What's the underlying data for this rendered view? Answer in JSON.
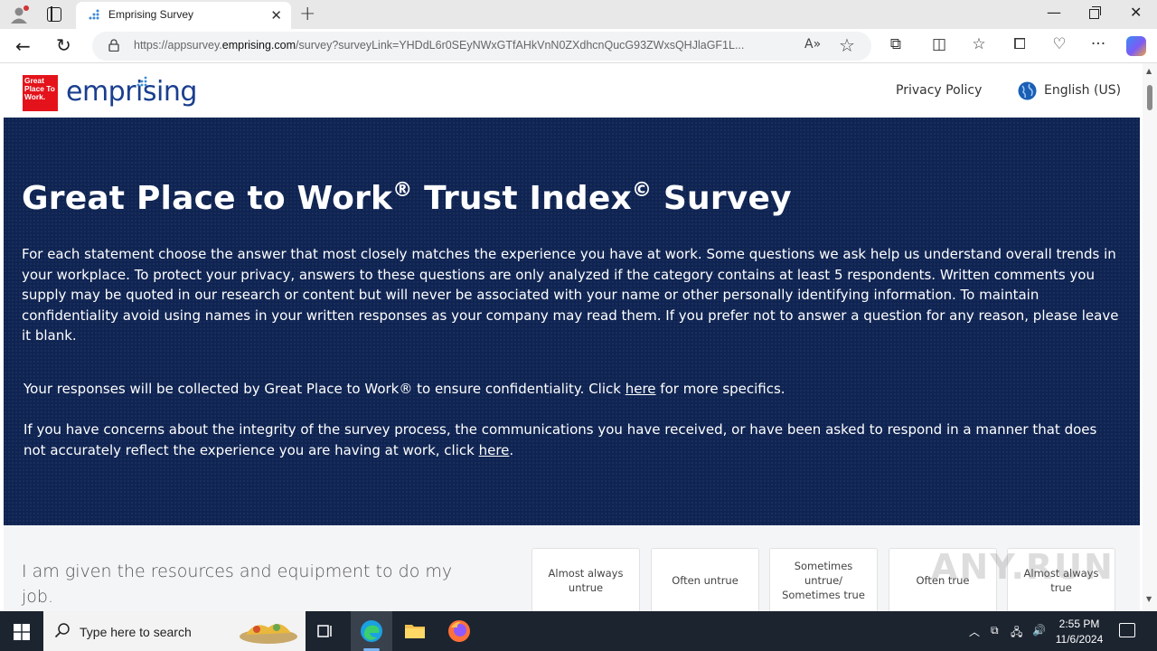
{
  "browser": {
    "tab_title": "Emprising Survey",
    "url_prefix": "https://appsurvey.",
    "url_domain": "emprising.com",
    "url_path": "/survey?surveyLink=YHDdL6r0SEyNWxGTfAHkVnN0ZXdhcnQucG93ZWxsQHJlaGF1L..."
  },
  "site": {
    "logo_text": "Great Place To Work.",
    "brand": "emprising",
    "privacy_policy": "Privacy Policy",
    "language": "English (US)"
  },
  "hero": {
    "title_a": "Great Place to Work",
    "title_reg": "®",
    "title_b": " Trust Index",
    "title_copy": "©",
    "title_c": " Survey",
    "intro": "For each statement choose the answer that most closely matches the experience you have at work. Some questions we ask help us understand overall trends in your workplace. To protect your privacy, answers to these questions are only analyzed if the category contains at least 5 respondents. Written comments you supply may be quoted in our research or content but will never be associated with your name or other personally identifying information. To maintain confidentiality avoid using names in your written responses as your company may read them. If you prefer not to answer a question for any reason, please leave it blank.",
    "p2_before": "Your responses will be collected by Great Place to Work® to ensure confidentiality. Click ",
    "p2_link": "here",
    "p2_after": " for more specifics.",
    "p3_before": "If you have concerns about the integrity of the survey process, the communications you have received, or have been asked to respond in a manner that does not accurately reflect the experience you are having at work, click ",
    "p3_link": "here",
    "p3_after": "."
  },
  "question": {
    "text": "I am given the resources and equipment to do my job.",
    "options": [
      "Almost always untrue",
      "Often untrue",
      "Sometimes untrue/ Sometimes true",
      "Often true",
      "Almost always true"
    ]
  },
  "watermark": "ANY.RUN",
  "taskbar": {
    "search_placeholder": "Type here to search",
    "time": "2:55 PM",
    "date": "11/6/2024"
  },
  "colors": {
    "hero_bg": "#0f2452",
    "brand_blue": "#1a3f8f",
    "gptw_red": "#e4131b"
  }
}
